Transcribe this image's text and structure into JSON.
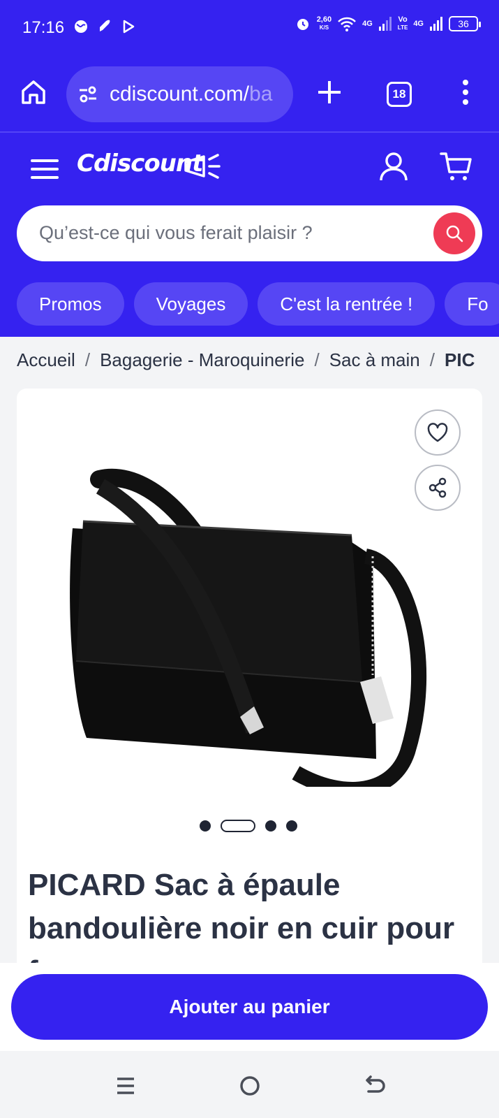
{
  "status": {
    "time": "17:16",
    "speed_value": "2,60",
    "speed_unit": "K/S",
    "net1": "4G",
    "volte_top": "Vo",
    "volte_bottom": "LTE",
    "net2": "4G",
    "battery": "36"
  },
  "browser": {
    "url_main": "cdiscount.com/",
    "url_tail": "ba",
    "tab_count": "18"
  },
  "header": {
    "logo": "Cdiscount"
  },
  "search": {
    "placeholder": "Qu’est-ce qui vous ferait plaisir ?"
  },
  "chips": [
    "Promos",
    "Voyages",
    "C'est la rentrée !",
    "Fo"
  ],
  "breadcrumb": {
    "items": [
      "Accueil",
      "Bagagerie - Maroquinerie",
      "Sac à main"
    ],
    "current": "PIC"
  },
  "product": {
    "title": "PICARD Sac à épaule bandoulière noir en cuir pour femme",
    "image_count": 4,
    "active_image": 2
  },
  "actions": {
    "add_to_cart": "Ajouter au panier"
  },
  "colors": {
    "brand": "#3522f0",
    "search_button": "#ef3b55"
  },
  "icons": [
    "home-icon",
    "site-settings-icon",
    "plus-icon",
    "menu-dots-icon",
    "hamburger-icon",
    "user-icon",
    "cart-icon",
    "search-icon",
    "heart-icon",
    "share-icon"
  ]
}
